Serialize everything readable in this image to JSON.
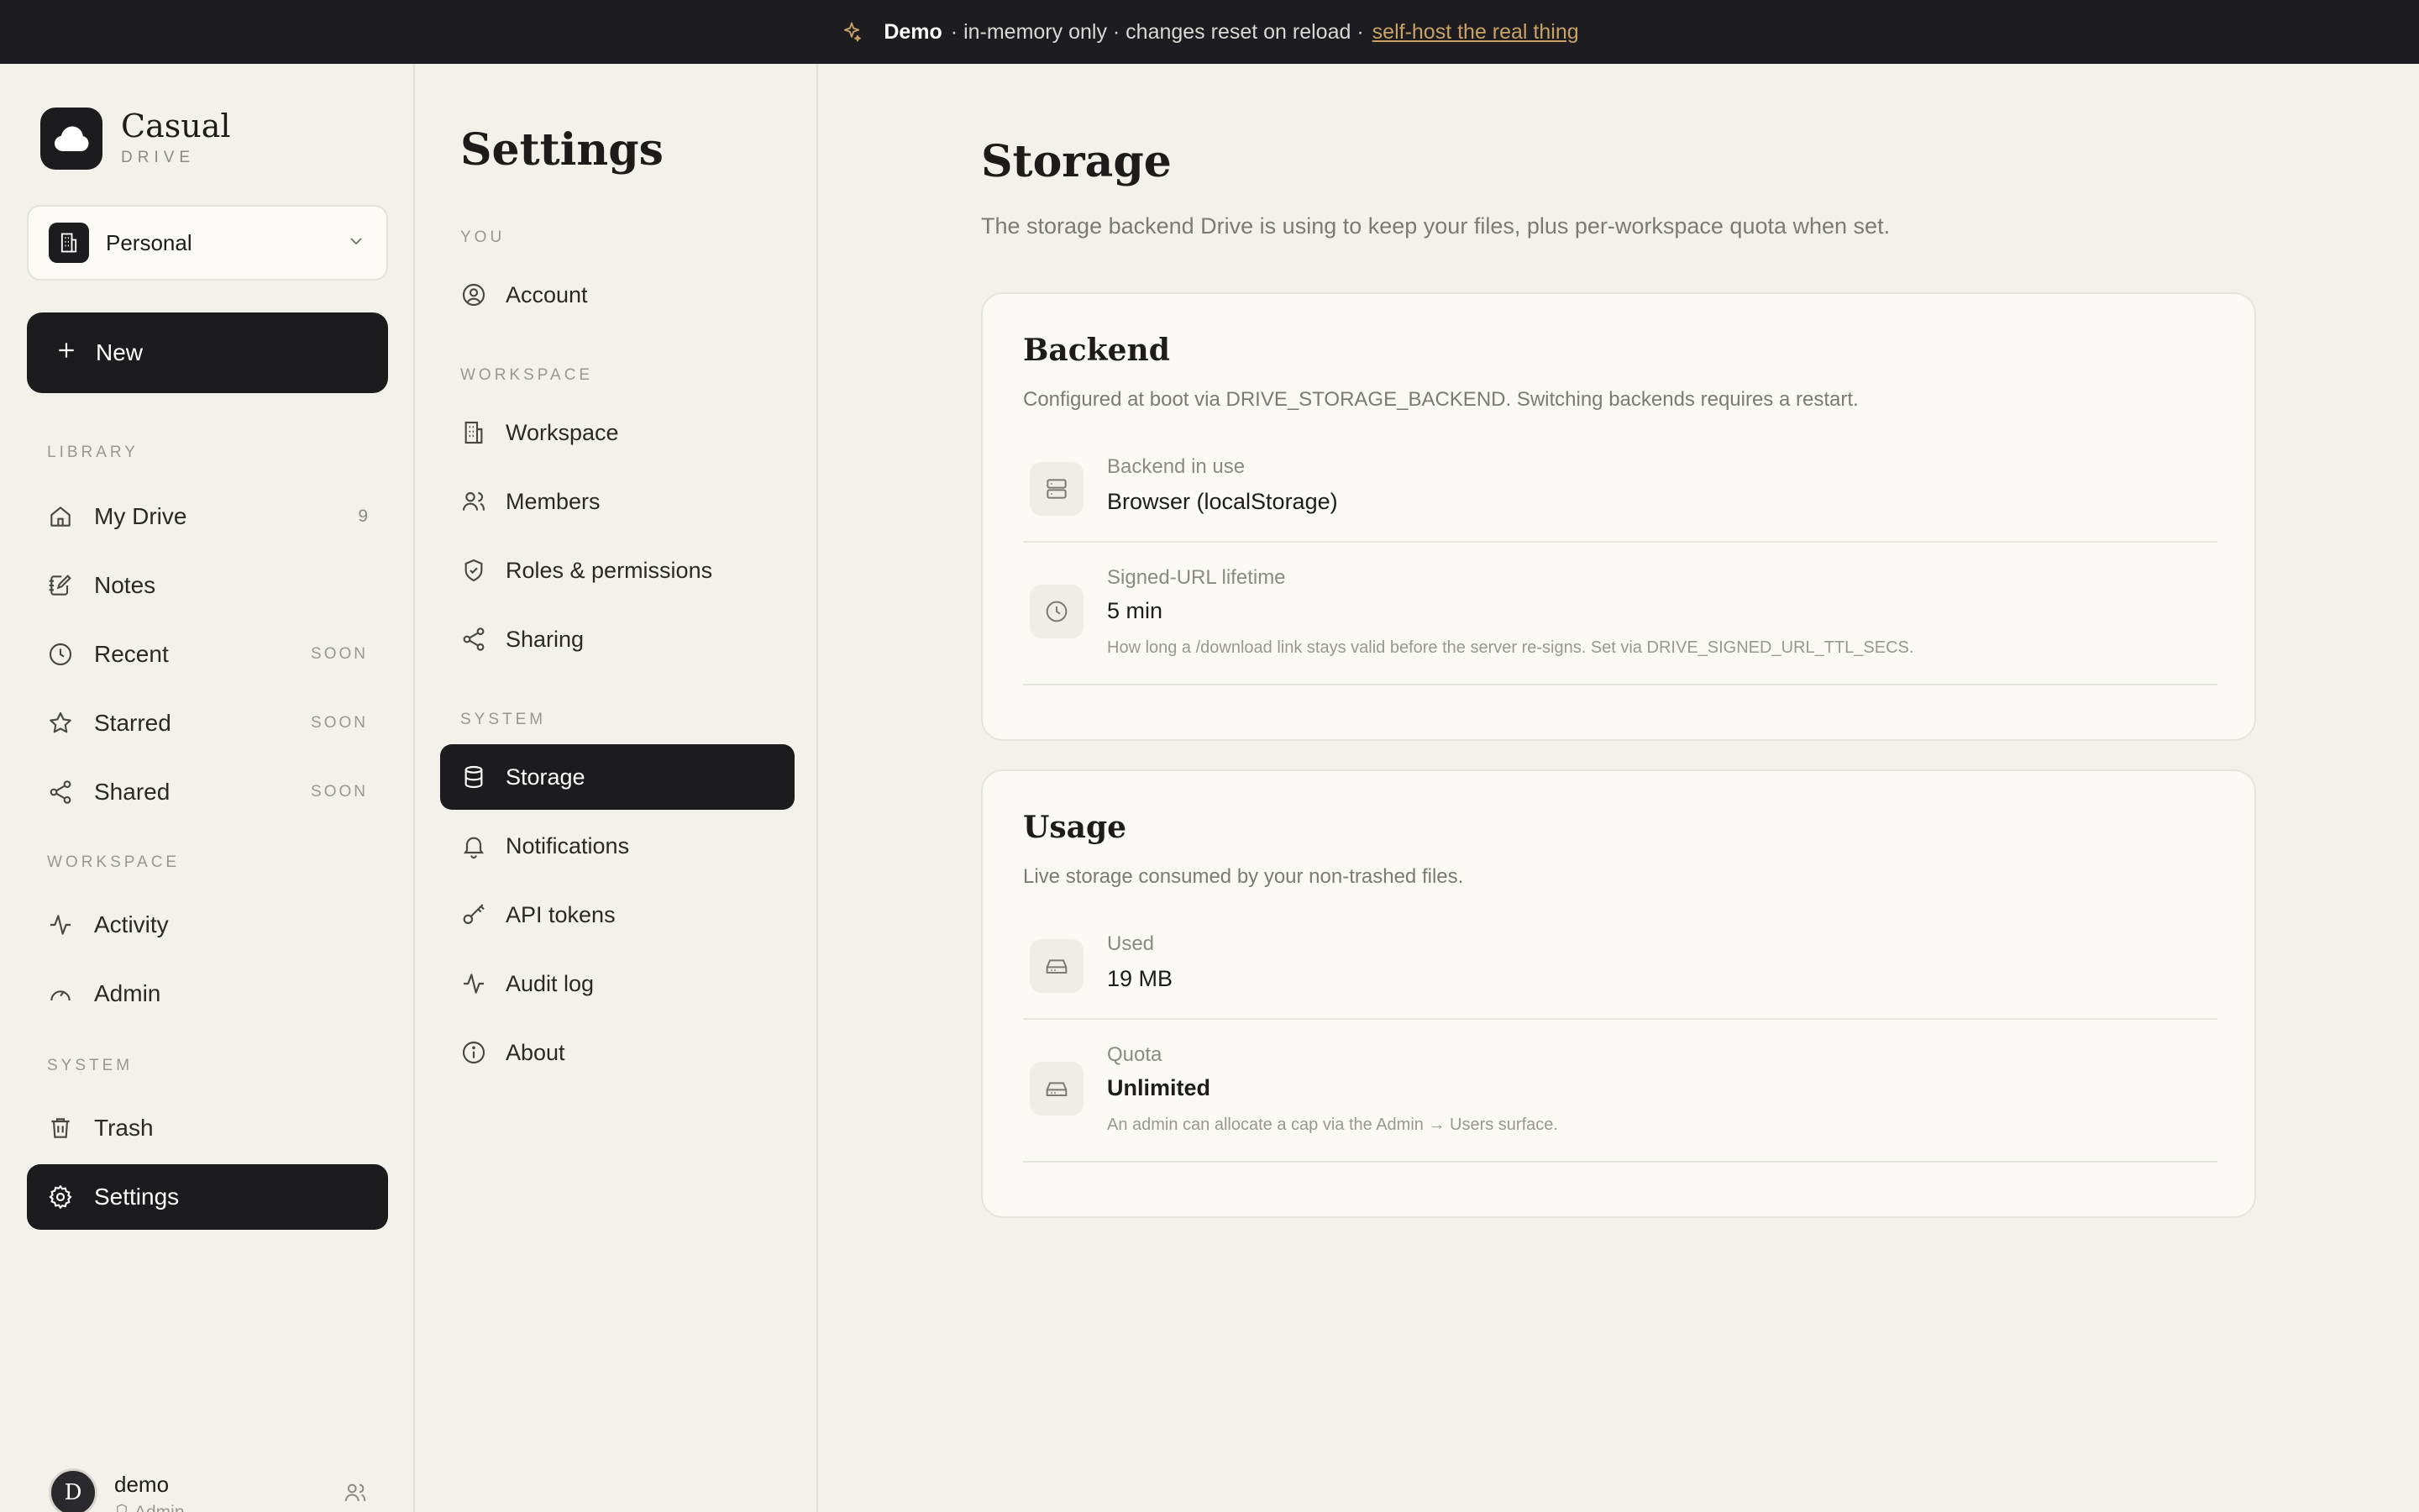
{
  "banner": {
    "demo": "Demo",
    "text": "· in-memory only · changes reset on reload ·",
    "link": "self-host the real thing"
  },
  "brand": {
    "name": "Casual",
    "sub": "DRIVE"
  },
  "workspace_select": {
    "value": "Personal"
  },
  "new_button": {
    "label": "New"
  },
  "sidebar": {
    "library_label": "LIBRARY",
    "my_drive": {
      "label": "My Drive",
      "count": "9"
    },
    "notes": {
      "label": "Notes"
    },
    "recent": {
      "label": "Recent",
      "tag": "SOON"
    },
    "starred": {
      "label": "Starred",
      "tag": "SOON"
    },
    "shared": {
      "label": "Shared",
      "tag": "SOON"
    },
    "workspace_label": "WORKSPACE",
    "activity": {
      "label": "Activity"
    },
    "admin": {
      "label": "Admin"
    },
    "system_label": "SYSTEM",
    "trash": {
      "label": "Trash"
    },
    "settings": {
      "label": "Settings"
    }
  },
  "user": {
    "initial": "D",
    "name": "demo",
    "role": "Admin"
  },
  "settings_nav": {
    "title": "Settings",
    "you_label": "YOU",
    "account": "Account",
    "workspace_label": "WORKSPACE",
    "workspace": "Workspace",
    "members": "Members",
    "roles": "Roles & permissions",
    "sharing": "Sharing",
    "system_label": "SYSTEM",
    "storage": "Storage",
    "notifications": "Notifications",
    "api_tokens": "API tokens",
    "audit_log": "Audit log",
    "about": "About"
  },
  "page": {
    "title": "Storage",
    "description": "The storage backend Drive is using to keep your files, plus per-workspace quota when set."
  },
  "backend_card": {
    "title": "Backend",
    "description": "Configured at boot via DRIVE_STORAGE_BACKEND. Switching backends requires a restart.",
    "backend_label": "Backend in use",
    "backend_value": "Browser (localStorage)",
    "ttl_label": "Signed-URL lifetime",
    "ttl_value": "5 min",
    "ttl_note": "How long a /download link stays valid before the server re-signs. Set via DRIVE_SIGNED_URL_TTL_SECS."
  },
  "usage_card": {
    "title": "Usage",
    "description": "Live storage consumed by your non-trashed files.",
    "used_label": "Used",
    "used_value": "19 MB",
    "quota_label": "Quota",
    "quota_value": "Unlimited",
    "quota_note": "An admin can allocate a cap via the Admin → Users surface."
  },
  "colors": {
    "background": "#f2f1ec",
    "dark": "#1c1c1e",
    "accent": "#c9a264",
    "card": "#faf9f6"
  }
}
